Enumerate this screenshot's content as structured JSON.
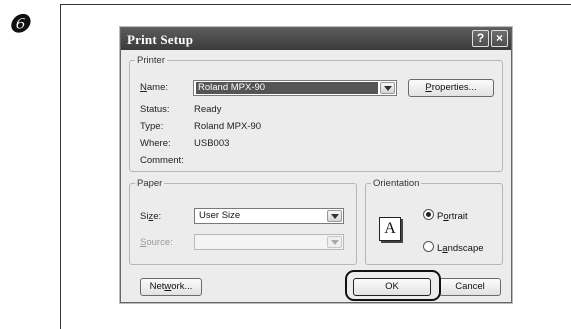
{
  "step": {
    "marker": "❻"
  },
  "dialog": {
    "title": "Print Setup",
    "help_glyph": "?",
    "close_glyph": "×"
  },
  "printer": {
    "legend": "Printer",
    "name_label_u": "N",
    "name_label_rest": "ame:",
    "name_value": "Roland MPX-90",
    "properties_u": "P",
    "properties_rest": "roperties...",
    "status_label": "Status:",
    "status_value": "Ready",
    "type_label": "Type:",
    "type_value": "Roland MPX-90",
    "where_label": "Where:",
    "where_value": "USB003",
    "comment_label": "Comment:",
    "comment_value": ""
  },
  "paper": {
    "legend": "Paper",
    "size_label_pre": "Si",
    "size_label_u": "z",
    "size_label_post": "e:",
    "size_value": "User Size",
    "source_label_u": "S",
    "source_label_rest": "ource:",
    "source_value": ""
  },
  "orientation": {
    "legend": "Orientation",
    "icon_letter": "A",
    "portrait_pre": "P",
    "portrait_u": "o",
    "portrait_post": "rtrait",
    "landscape_pre": "L",
    "landscape_u": "a",
    "landscape_post": "ndscape",
    "selected": "portrait"
  },
  "buttons": {
    "network_pre": "Net",
    "network_u": "w",
    "network_post": "ork...",
    "ok": "OK",
    "cancel": "Cancel"
  }
}
